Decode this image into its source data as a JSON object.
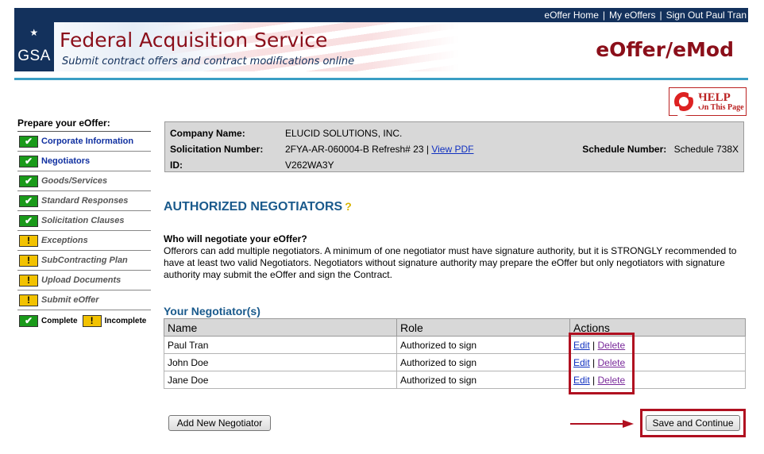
{
  "topnav": {
    "links": [
      "eOffer Home",
      "My eOffers",
      "Sign Out Paul Tran"
    ],
    "separator": "|"
  },
  "banner": {
    "logo": "GSA",
    "title": "Federal Acquisition Service",
    "subtitle": "Submit contract offers and contract modifications online",
    "brand": "eOffer/eMod"
  },
  "help": {
    "line1": "HELP",
    "line2": "On This Page",
    "icon": "lifebuoy-icon"
  },
  "sidebar": {
    "heading": "Prepare your eOffer:",
    "items": [
      {
        "label": "Corporate Information",
        "status": "complete",
        "style": "link"
      },
      {
        "label": "Negotiators",
        "status": "complete",
        "style": "link"
      },
      {
        "label": "Goods/Services",
        "status": "complete",
        "style": "inactive"
      },
      {
        "label": "Standard Responses",
        "status": "complete",
        "style": "inactive"
      },
      {
        "label": "Solicitation Clauses",
        "status": "complete",
        "style": "inactive"
      },
      {
        "label": "Exceptions",
        "status": "incomplete",
        "style": "inactive"
      },
      {
        "label": "SubContracting Plan",
        "status": "incomplete",
        "style": "inactive"
      },
      {
        "label": "Upload Documents",
        "status": "incomplete",
        "style": "inactive"
      },
      {
        "label": "Submit eOffer",
        "status": "incomplete",
        "style": "inactive"
      }
    ],
    "legend": {
      "complete": "Complete",
      "incomplete": "Incomplete",
      "check_glyph": "✔",
      "warn_glyph": "!"
    }
  },
  "info": {
    "company_label": "Company Name:",
    "company_value": "ELUCID SOLUTIONS, INC.",
    "solicitation_label": "Solicitation Number:",
    "solicitation_value": "2FYA-AR-060004-B Refresh# 23 |",
    "view_pdf": "View PDF",
    "schedule_label": "Schedule Number:",
    "schedule_value": "Schedule 738X",
    "id_label": "ID:",
    "id_value": "V262WA3Y"
  },
  "section": {
    "title": "AUTHORIZED NEGOTIATORS",
    "question": "Who will negotiate your eOffer?",
    "description": "Offerors can add multiple negotiators. A minimum of one negotiator must have signature authority, but it is STRONGLY recommended to have at least two valid Negotiators. Negotiators without signature authority may prepare the eOffer but only negotiators with signature authority may submit the eOffer and sign the Contract."
  },
  "negotiators": {
    "title": "Your Negotiator(s)",
    "columns": [
      "Name",
      "Role",
      "Actions"
    ],
    "rows": [
      {
        "name": "Paul Tran",
        "role": "Authorized to sign",
        "edit": "Edit",
        "delete": "Delete"
      },
      {
        "name": "John Doe",
        "role": "Authorized to sign",
        "edit": "Edit",
        "delete": "Delete"
      },
      {
        "name": "Jane Doe",
        "role": "Authorized to sign",
        "edit": "Edit",
        "delete": "Delete"
      }
    ]
  },
  "buttons": {
    "add": "Add New Negotiator",
    "save": "Save and Continue"
  },
  "colors": {
    "navy": "#13315c",
    "maroon": "#8b0f1a",
    "section_blue": "#1a5a8c",
    "highlight_red": "#b01020"
  }
}
